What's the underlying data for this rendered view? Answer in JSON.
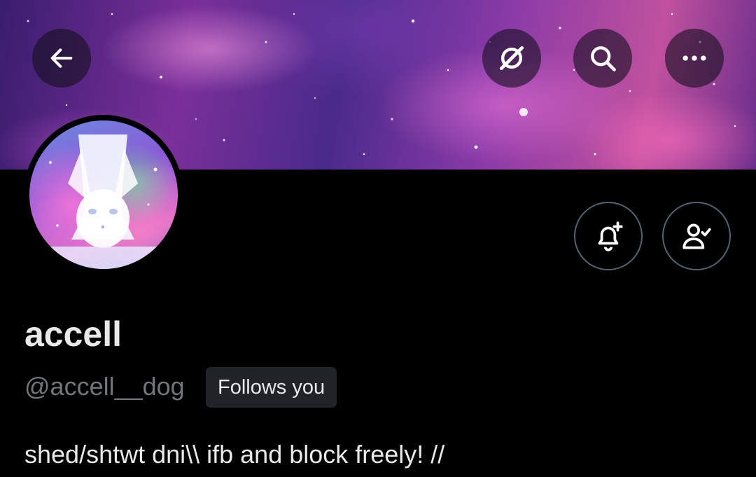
{
  "header": {
    "back_icon": "arrow-left-icon",
    "grok_icon": "grok-icon",
    "search_icon": "search-icon",
    "more_icon": "more-icon"
  },
  "profile": {
    "display_name": "accell",
    "handle": "@accell__dog",
    "follows_you_label": "Follows you",
    "bio": "shed/shtwt dni\\\\ ifb and block freely! //"
  },
  "actions": {
    "notify_icon": "bell-plus-icon",
    "following_icon": "person-check-icon"
  },
  "colors": {
    "background": "#000000",
    "primary_text": "#e7e9ea",
    "secondary_text": "#71767b",
    "badge_bg": "#202327",
    "button_border": "#536471"
  }
}
